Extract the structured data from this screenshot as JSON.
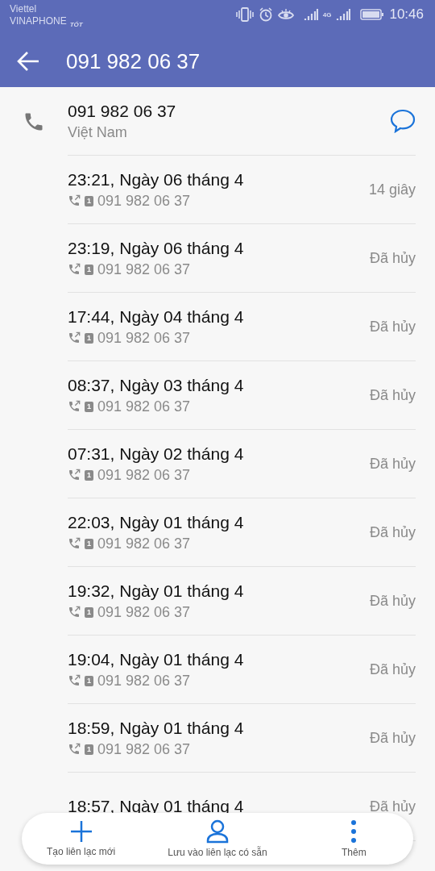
{
  "status_bar": {
    "carrier_1": "Viettel",
    "carrier_2": "VINAPHONE",
    "signal_quality": "TỐT",
    "network": "4G",
    "time": "10:46"
  },
  "app_bar": {
    "title": "091 982 06 37"
  },
  "contact": {
    "number": "091 982 06 37",
    "region": "Việt Nam"
  },
  "calls": [
    {
      "time": "23:21, Ngày 06 tháng 4",
      "sim": "1",
      "number": "091 982 06 37",
      "result": "14 giây"
    },
    {
      "time": "23:19, Ngày 06 tháng 4",
      "sim": "1",
      "number": "091 982 06 37",
      "result": "Đã hủy"
    },
    {
      "time": "17:44, Ngày 04 tháng 4",
      "sim": "1",
      "number": "091 982 06 37",
      "result": "Đã hủy"
    },
    {
      "time": "08:37, Ngày 03 tháng 4",
      "sim": "1",
      "number": "091 982 06 37",
      "result": "Đã hủy"
    },
    {
      "time": "07:31, Ngày 02 tháng 4",
      "sim": "1",
      "number": "091 982 06 37",
      "result": "Đã hủy"
    },
    {
      "time": "22:03, Ngày 01 tháng 4",
      "sim": "1",
      "number": "091 982 06 37",
      "result": "Đã hủy"
    },
    {
      "time": "19:32, Ngày 01 tháng 4",
      "sim": "1",
      "number": "091 982 06 37",
      "result": "Đã hủy"
    },
    {
      "time": "19:04, Ngày 01 tháng 4",
      "sim": "1",
      "number": "091 982 06 37",
      "result": "Đã hủy"
    },
    {
      "time": "18:59, Ngày 01 tháng 4",
      "sim": "1",
      "number": "091 982 06 37",
      "result": "Đã hủy"
    },
    {
      "time": "18:57, Ngày 01 tháng 4",
      "result": "Đã hủy"
    }
  ],
  "bottom_bar": [
    {
      "kind": "add",
      "label": "Tạo liên lạc mới"
    },
    {
      "kind": "person",
      "label": "Lưu vào liên lạc có sẵn"
    },
    {
      "kind": "more",
      "label": "Thêm"
    }
  ]
}
